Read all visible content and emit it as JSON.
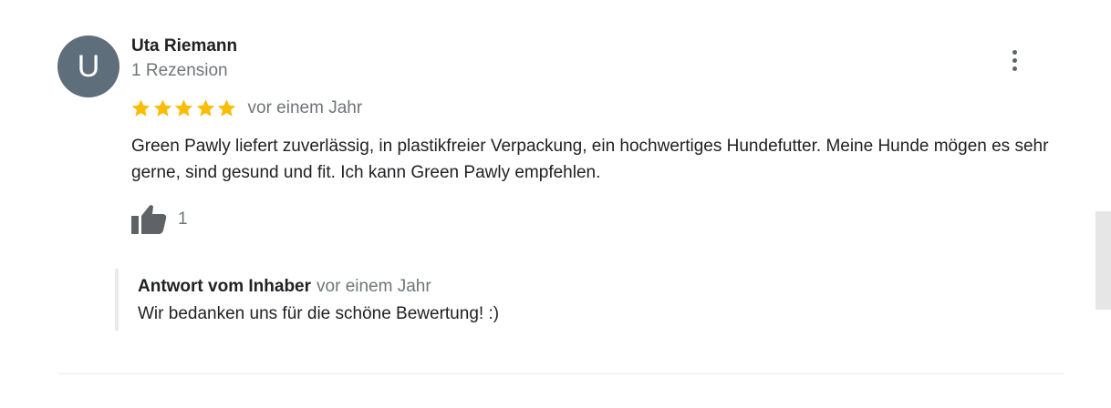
{
  "review": {
    "avatar_letter": "U",
    "author_name": "Uta Riemann",
    "review_count": "1 Rezension",
    "rating": 5,
    "rating_max": 5,
    "date": "vor einem Jahr",
    "text": "Green Pawly liefert zuverlässig, in plastikfreier Verpackung, ein hochwertiges Hundefutter. Meine Hunde mögen es sehr gerne, sind gesund und fit. Ich kann Green Pawly empfehlen.",
    "like_count": "1",
    "menu_icon": "more-vert-icon",
    "like_icon": "thumb-up-icon"
  },
  "owner_reply": {
    "author": "Antwort vom Inhaber",
    "date": "vor einem Jahr",
    "text": "Wir bedanken uns für die schöne Bewertung! :)"
  },
  "colors": {
    "avatar_bg": "#5f6e7b",
    "star": "#fbbc04",
    "secondary_text": "#70757a",
    "primary_text": "#202124"
  }
}
